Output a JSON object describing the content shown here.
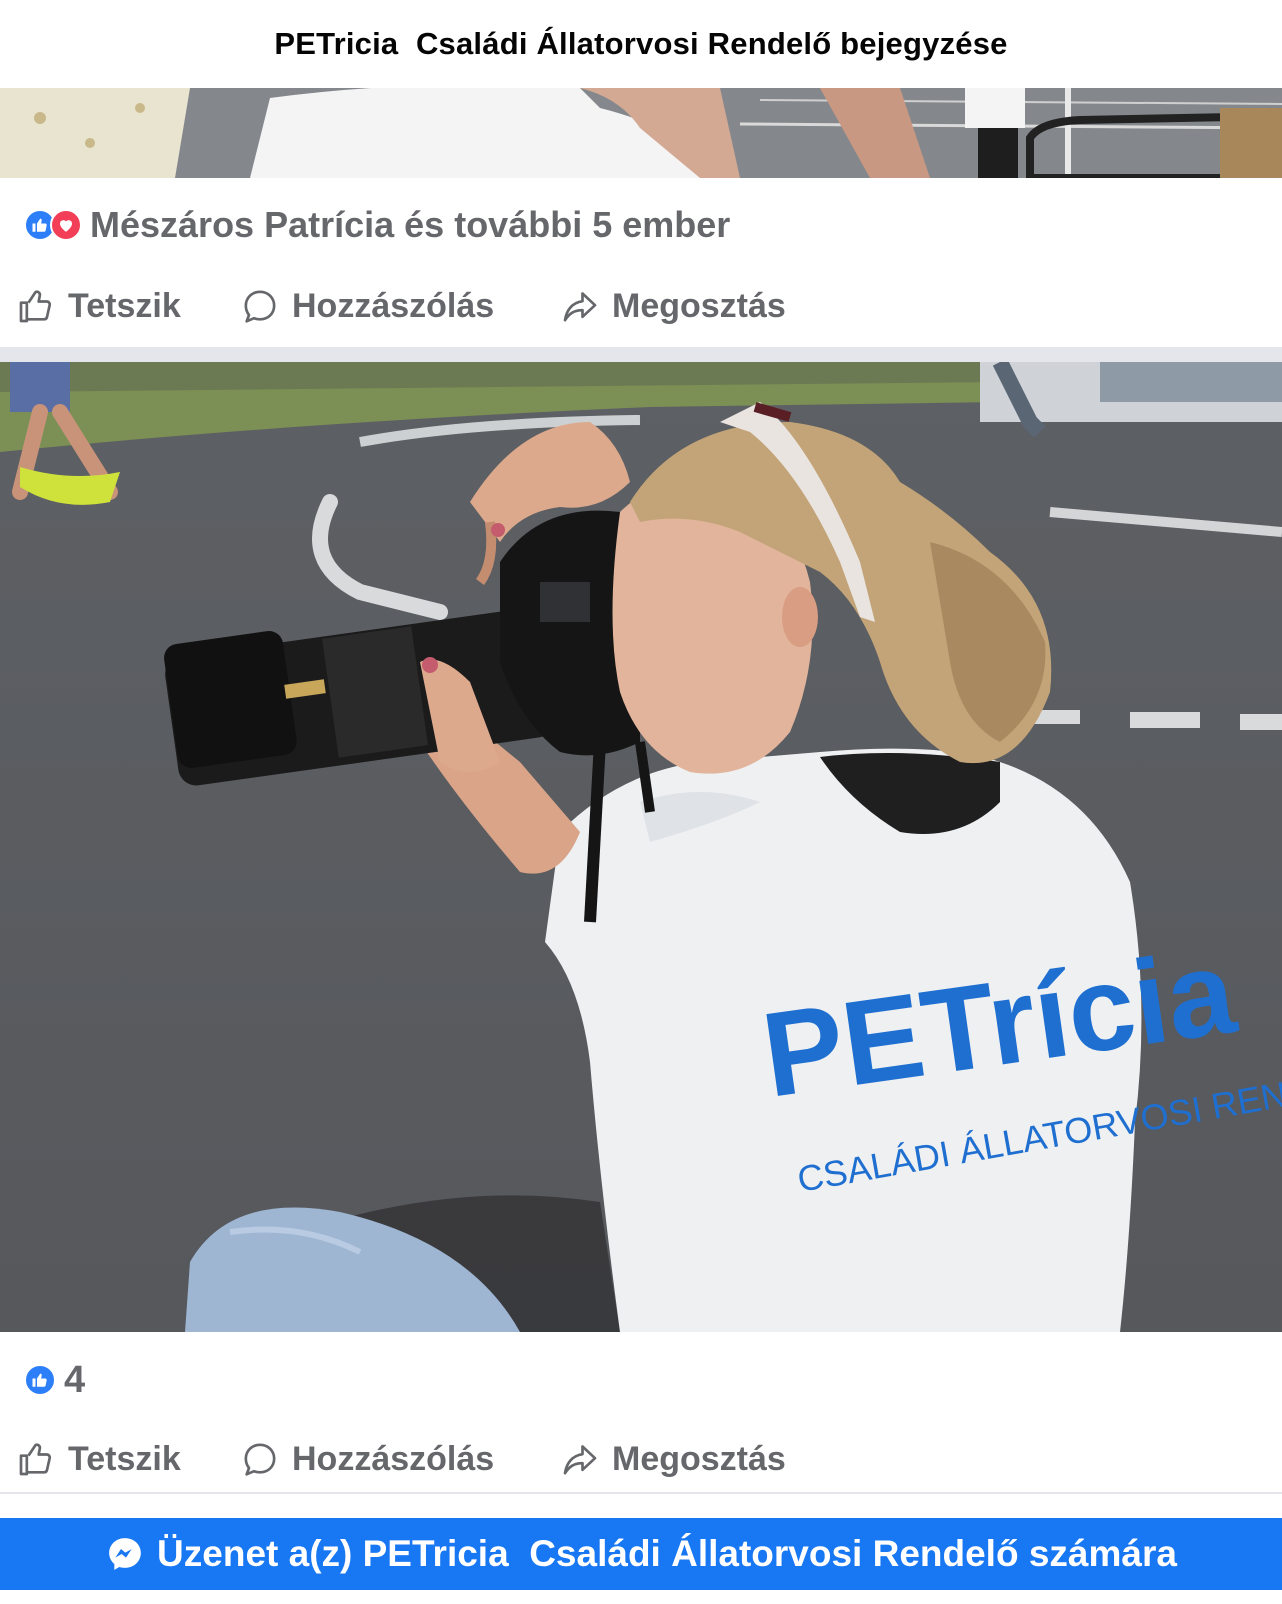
{
  "header": {
    "title": "PETricia  Családi Állatorvosi Rendelő bejegyzése"
  },
  "posts": [
    {
      "reactions": {
        "icons": [
          "like-icon",
          "love-icon"
        ],
        "text": "Mészáros Patrícia és további 5 ember"
      },
      "actions": {
        "like_label": "Tetszik",
        "comment_label": "Hozzászólás",
        "share_label": "Megosztás"
      }
    },
    {
      "photo": {
        "shirt_logo": "PETrícia",
        "shirt_subtitle": "CSALÁDI ÁLLATORVOSI REN"
      },
      "reactions": {
        "icons": [
          "like-icon"
        ],
        "count": "4"
      },
      "actions": {
        "like_label": "Tetszik",
        "comment_label": "Hozzászólás",
        "share_label": "Megosztás"
      }
    }
  ],
  "message_button": {
    "label": "Üzenet a(z) PETricia  Családi Állatorvosi Rendelő számára",
    "icon": "messenger-icon"
  },
  "colors": {
    "brand_blue": "#1877f2",
    "like_blue": "#2d7ff9",
    "love_red": "#f33e58",
    "secondary_text": "#65676b",
    "separator": "#e4e6eb",
    "shirt_logo_blue": "#1f6fd1"
  }
}
